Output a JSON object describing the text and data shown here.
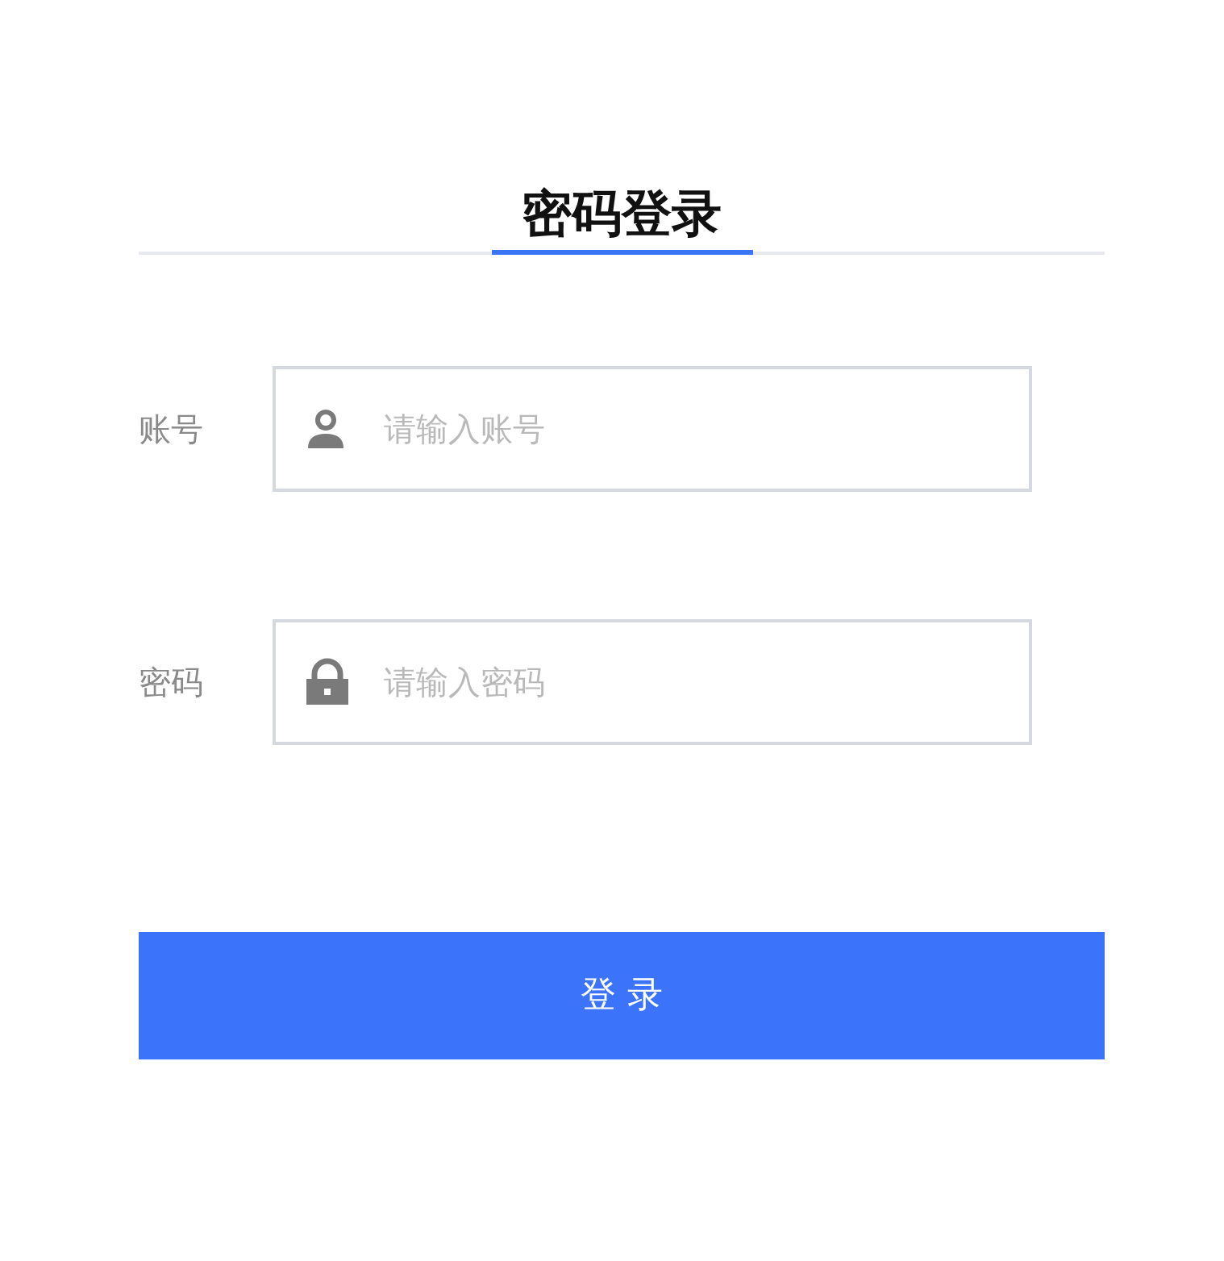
{
  "tabs": [
    {
      "label": "密码登录",
      "selected": true
    }
  ],
  "fields": [
    {
      "label": "账号",
      "kind": "user",
      "placeholder": "请输入账号"
    },
    {
      "label": "密码",
      "kind": "lock",
      "placeholder": "请输入密码"
    }
  ],
  "button": {
    "label": "登 录"
  }
}
